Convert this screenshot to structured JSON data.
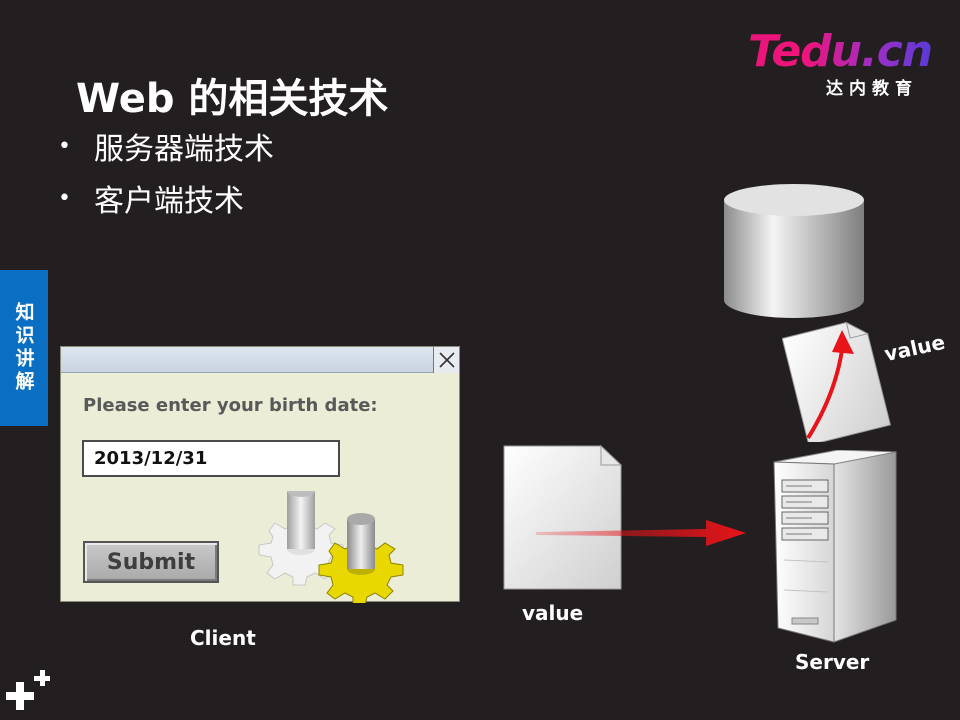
{
  "logo": {
    "brand": "Tedu.cn",
    "subtitle": "达内教育"
  },
  "slide": {
    "title": "Web 的相关技术",
    "bullets": [
      "服务器端技术",
      "客户端技术"
    ],
    "side_tab": "知识讲解"
  },
  "dialog": {
    "prompt": "Please enter your birth date:",
    "date_value": "2013/12/31",
    "submit_label": "Submit"
  },
  "diagram": {
    "client_label": "Client",
    "value_label_request": "value",
    "value_label_db": "value",
    "server_label": "Server"
  },
  "colors": {
    "background": "#231f20",
    "side_tab": "#0a6fc2",
    "arrow": "#e8141a",
    "dialog_bg": "#ebedd7",
    "gear_white": "#f2f2f2",
    "gear_yellow": "#e8d800"
  },
  "icons": [
    "close-icon",
    "database-icon",
    "document-icon",
    "server-icon",
    "gear-icon",
    "plus-icon"
  ]
}
